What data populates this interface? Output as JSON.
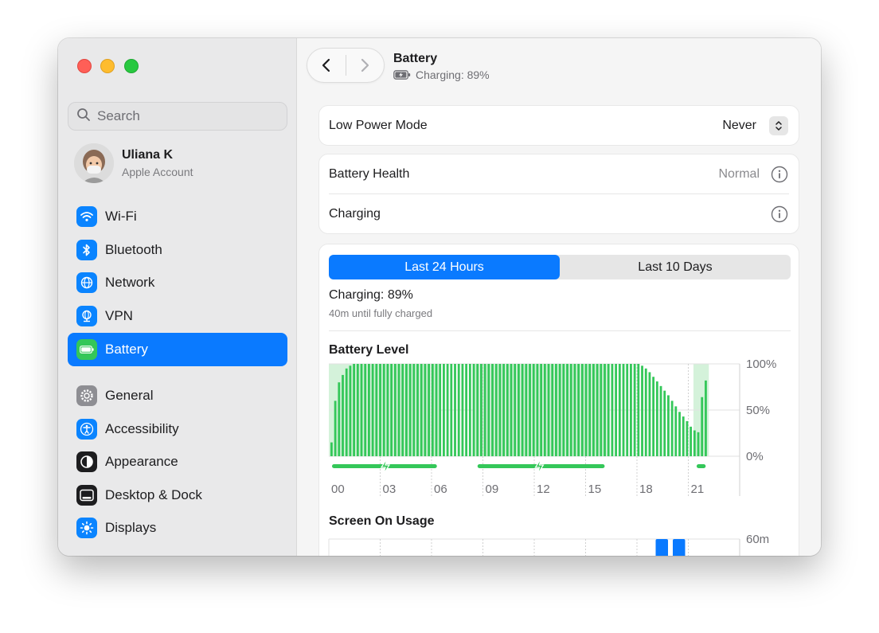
{
  "sidebar": {
    "search_placeholder": "Search",
    "account": {
      "name": "Uliana K",
      "subtitle": "Apple Account"
    },
    "items": [
      {
        "label": "Wi-Fi",
        "icon": "wifi-icon",
        "color": "#0a84ff"
      },
      {
        "label": "Bluetooth",
        "icon": "bluetooth-icon",
        "color": "#0a84ff"
      },
      {
        "label": "Network",
        "icon": "globe-icon",
        "color": "#0a84ff"
      },
      {
        "label": "VPN",
        "icon": "vpn-globe-icon",
        "color": "#0a84ff"
      },
      {
        "label": "Battery",
        "icon": "battery-icon",
        "color": "#34c759",
        "active": true
      },
      {
        "label": "General",
        "icon": "gear-icon",
        "color": "#8e8e93"
      },
      {
        "label": "Accessibility",
        "icon": "accessibility-icon",
        "color": "#0a84ff"
      },
      {
        "label": "Appearance",
        "icon": "appearance-icon",
        "color": "#1d1d1f"
      },
      {
        "label": "Desktop & Dock",
        "icon": "dock-icon",
        "color": "#1d1d1f"
      },
      {
        "label": "Displays",
        "icon": "sun-icon",
        "color": "#0a84ff"
      }
    ]
  },
  "header": {
    "title": "Battery",
    "subtitle": "Charging: 89%"
  },
  "low_power": {
    "label": "Low Power Mode",
    "value": "Never"
  },
  "health": {
    "label": "Battery Health",
    "value": "Normal"
  },
  "charging_row": {
    "label": "Charging"
  },
  "usage_card": {
    "tabs": [
      "Last 24 Hours",
      "Last 10 Days"
    ],
    "selected_tab": 0,
    "status": "Charging: 89%",
    "status_detail": "40m until fully charged",
    "level_title": "Battery Level",
    "usage_title": "Screen On Usage"
  },
  "colors": {
    "accent": "#0a7aff",
    "battery_green": "#34c759",
    "charging_shade": "#d4f2da"
  },
  "chart_data": [
    {
      "type": "bar",
      "title": "Battery Level",
      "x_tick_labels": [
        "00",
        "03",
        "06",
        "09",
        "12",
        "15",
        "18",
        "21"
      ],
      "y_tick_labels": [
        "100%",
        "50%",
        "0%"
      ],
      "ylim": [
        0,
        100
      ],
      "values": [
        15,
        60,
        80,
        88,
        95,
        98,
        100,
        100,
        100,
        100,
        100,
        100,
        100,
        100,
        100,
        100,
        100,
        100,
        100,
        100,
        100,
        100,
        100,
        100,
        100,
        100,
        100,
        100,
        100,
        100,
        100,
        100,
        100,
        100,
        100,
        100,
        100,
        100,
        100,
        100,
        100,
        100,
        100,
        100,
        100,
        100,
        100,
        100,
        100,
        100,
        100,
        100,
        100,
        100,
        100,
        100,
        100,
        100,
        100,
        100,
        100,
        100,
        100,
        100,
        100,
        100,
        100,
        100,
        100,
        100,
        100,
        100,
        100,
        100,
        100,
        100,
        100,
        100,
        100,
        100,
        100,
        100,
        100,
        98,
        95,
        91,
        86,
        81,
        76,
        71,
        66,
        60,
        54,
        48,
        43,
        38,
        32,
        28,
        26,
        64,
        82
      ],
      "charging_periods": [
        [
          0,
          6.5
        ],
        [
          8.5,
          16.3
        ],
        [
          21.3,
          22.2
        ]
      ],
      "charging_icon_hours": [
        3.3,
        12.3
      ],
      "grid": true
    },
    {
      "type": "bar",
      "title": "Screen On Usage",
      "y_tick_labels": [
        "60m"
      ],
      "ylim": [
        0,
        60
      ],
      "hour_values": [
        0,
        0,
        0,
        0,
        0,
        0,
        0,
        0,
        0,
        0,
        0,
        0,
        0,
        0,
        0,
        0,
        0,
        0,
        0,
        60,
        60,
        0,
        0,
        0
      ],
      "grid": true
    }
  ]
}
